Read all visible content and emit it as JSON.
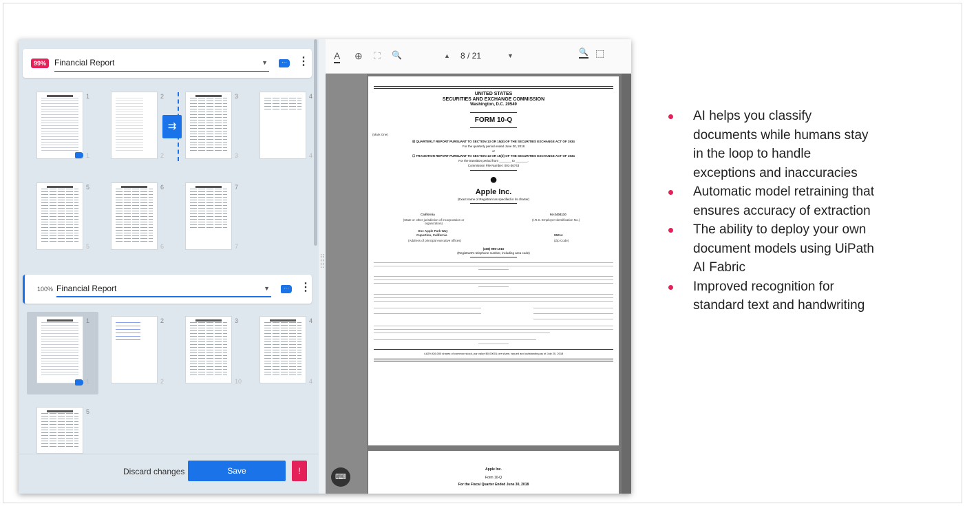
{
  "left_panel": {
    "groups": [
      {
        "confidence": "99%",
        "doc_type": "Financial Report",
        "pages": [
          {
            "num": "1",
            "sub": "1"
          },
          {
            "num": "2",
            "sub": "2"
          },
          {
            "num": "3",
            "sub": "3"
          },
          {
            "num": "4",
            "sub": "4"
          },
          {
            "num": "5",
            "sub": "5"
          },
          {
            "num": "6",
            "sub": "6"
          },
          {
            "num": "7",
            "sub": "7"
          }
        ]
      },
      {
        "confidence": "100%",
        "doc_type": "Financial Report",
        "pages": [
          {
            "num": "1",
            "sub": "1"
          },
          {
            "num": "2",
            "sub": "2"
          },
          {
            "num": "3",
            "sub": "10"
          },
          {
            "num": "4",
            "sub": "4"
          },
          {
            "num": "5",
            "sub": ""
          }
        ]
      }
    ],
    "footer": {
      "discard_label": "Discard changes",
      "save_label": "Save",
      "alert_label": "!"
    }
  },
  "viewer": {
    "toolbar": {
      "text_tool": "A",
      "zoom_in": "⊕",
      "fit": "⛶",
      "zoom_out": "🔍",
      "prev": "▲",
      "page": "8 / 21",
      "next": "▼",
      "search": "🔍",
      "select": "⬚"
    },
    "document": {
      "title1": "UNITED STATES",
      "title2": "SECURITIES AND EXCHANGE COMMISSION",
      "title3": "Washington, D.C. 20549",
      "form": "FORM 10-Q",
      "mark_one": "(Mark One)",
      "quarterly": "☒ QUARTERLY REPORT PURSUANT TO SECTION 13 OR 15(d) OF THE SECURITIES EXCHANGE ACT OF 1934",
      "period": "For the quarterly period ended June 30, 2018",
      "or": "or",
      "transition": "☐ TRANSITION REPORT PURSUANT TO SECTION 13 OR 15(d) OF THE SECURITIES EXCHANGE ACT OF 1934",
      "transition_period": "For the transition period from _______ to _______.",
      "file_number": "Commission File Number: 001-36743",
      "company": "Apple Inc.",
      "company_sub": "(Exact name of Registrant as specified in its charter)",
      "state": "California",
      "state_sub": "(State or other jurisdiction of incorporation or organization)",
      "ein": "94-2404110",
      "ein_sub": "(I.R.S. Employer Identification No.)",
      "address": "One Apple Park Way",
      "city": "Cupertino, California",
      "address_sub": "(Address of principal executive offices)",
      "zip": "95014",
      "zip_sub": "(Zip Code)",
      "phone": "(408) 996-1010",
      "phone_sub": "(Registrant's telephone number, including area code)",
      "shares": "4,829,926,000 shares of common stock, par value $0.00001 per share, issued and outstanding as of July 20, 2018",
      "p2_company": "Apple Inc.",
      "p2_form": "Form 10-Q",
      "p2_period": "For the Fiscal Quarter Ended June 30, 2018"
    },
    "keyboard_icon": "⌨"
  },
  "bullets": [
    "AI helps you classify documents while humans stay in the loop to handle exceptions and inaccuracies",
    "Automatic model retraining that ensures accuracy of extraction",
    "The ability to deploy your own document models using UiPath AI Fabric",
    "Improved recognition for standard text and handwriting"
  ],
  "colors": {
    "accent": "#1a73e8",
    "alert": "#e5215a"
  }
}
